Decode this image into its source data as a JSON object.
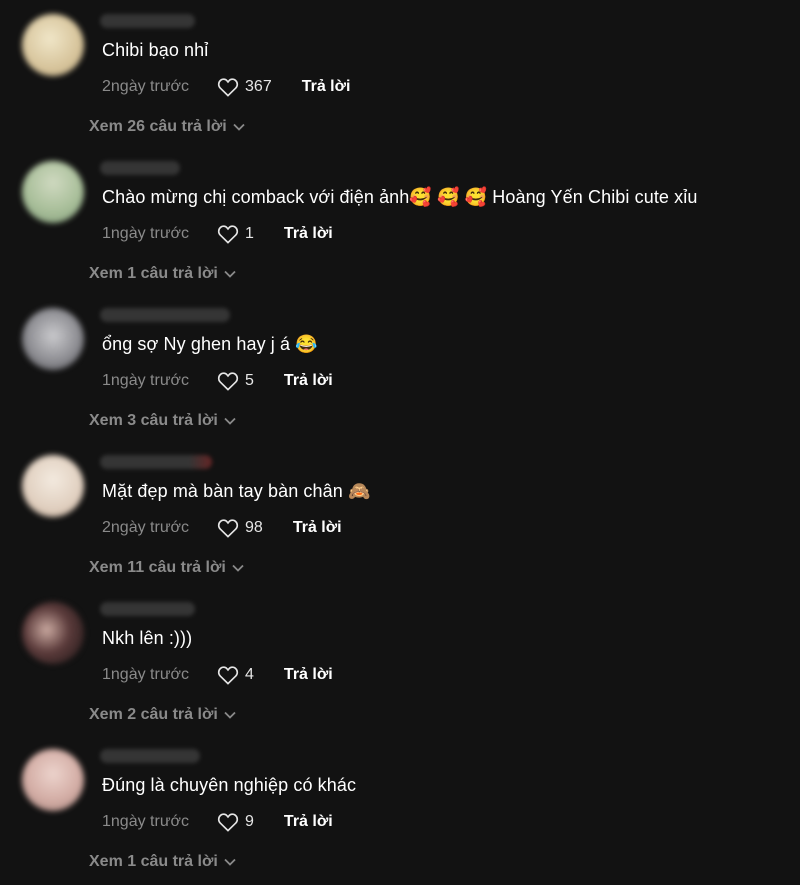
{
  "comments": [
    {
      "text": "Chibi bạo nhỉ",
      "time": "2ngày trước",
      "likes": "367",
      "reply": "Trả lời",
      "view_replies": "Xem 26 câu trả lời",
      "avatar_color": "#d9c9a3"
    },
    {
      "text": "Chào mừng chị comback với điện ảnh🥰 🥰 🥰  Hoàng Yến Chibi cute xỉu",
      "time": "1ngày trước",
      "likes": "1",
      "reply": "Trả lời",
      "view_replies": "Xem 1 câu trả lời",
      "avatar_color": "#b9c9a8"
    },
    {
      "text": "ổng sợ Ny ghen hay j á 😂",
      "time": "1ngày trước",
      "likes": "5",
      "reply": "Trả lời",
      "view_replies": "Xem 3 câu trả lời",
      "avatar_color": "#8f8f93"
    },
    {
      "text": "Mặt đẹp mà bàn tay bàn chân 🙈",
      "time": "2ngày trước",
      "likes": "98",
      "reply": "Trả lời",
      "view_replies": "Xem 11 câu trả lời",
      "avatar_color": "#e6d8c8"
    },
    {
      "text": "Nkh lên :)))",
      "time": "1ngày trước",
      "likes": "4",
      "reply": "Trả lời",
      "view_replies": "Xem 2 câu trả lời",
      "avatar_color": "#5a3a3a"
    },
    {
      "text": "Đúng là chuyên nghiệp có khác",
      "time": "1ngày trước",
      "likes": "9",
      "reply": "Trả lời",
      "view_replies": "Xem 1 câu trả lời",
      "avatar_color": "#d8b6b0"
    }
  ],
  "icons": {
    "like": "heart-outline-icon",
    "expand": "chevron-down-icon"
  }
}
